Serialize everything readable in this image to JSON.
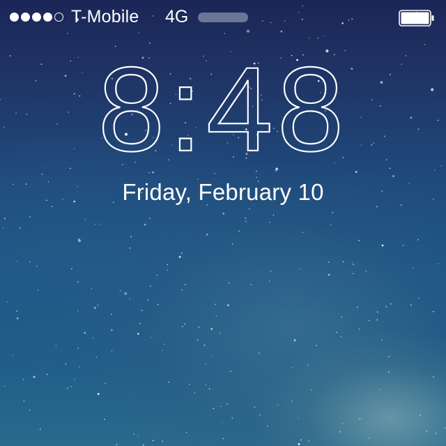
{
  "status_bar": {
    "signal_strength": {
      "filled": 4,
      "total": 5
    },
    "carrier": "T-Mobile",
    "network": "4G",
    "battery_level": 1.0
  },
  "lock_screen": {
    "time": "8:48",
    "date": "Friday, February 10"
  },
  "icons": {
    "signal": "signal-dots-icon",
    "battery": "battery-icon"
  },
  "colors": {
    "text": "#ffffff",
    "sky_top": "#1b2657",
    "sky_bottom": "#2a6a8d",
    "activity_bar": "#6b7596"
  }
}
